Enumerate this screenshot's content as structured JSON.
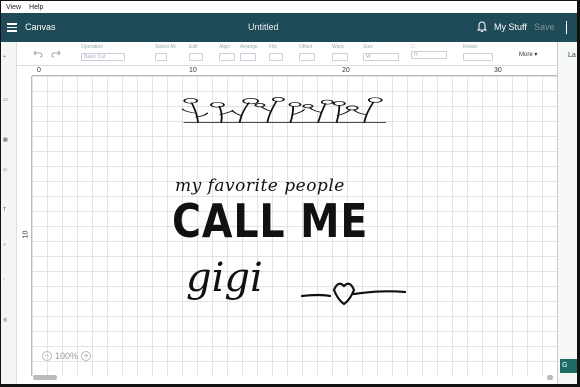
{
  "menu": {
    "items": [
      "View",
      "Help"
    ]
  },
  "titlebar": {
    "app": "Canvas",
    "document": "Untitled",
    "my_stuff": "My Stuff",
    "save": "Save"
  },
  "toolbar": {
    "tools": [
      {
        "label": "Operation",
        "value": "Basic Cut"
      },
      {
        "label": "Select All",
        "value": ""
      },
      {
        "label": "Edit",
        "value": ""
      },
      {
        "label": "Align",
        "value": ""
      },
      {
        "label": "Arrange",
        "value": ""
      },
      {
        "label": "Flip",
        "value": ""
      },
      {
        "label": "Offset",
        "value": ""
      },
      {
        "label": "Warp",
        "value": ""
      },
      {
        "label": "Size",
        "value": "W"
      },
      {
        "label": "",
        "value": "H"
      },
      {
        "label": "Rotate",
        "value": ""
      },
      {
        "label": "More ▾",
        "value": ""
      }
    ]
  },
  "ruler": {
    "h_ticks": [
      "0",
      "10",
      "20",
      "30"
    ],
    "v_ticks": [
      "10"
    ]
  },
  "design": {
    "line1": "my favorite people",
    "line2": "CALL ME",
    "line3": "gigi"
  },
  "zoom": {
    "level": "100%",
    "minus": "−",
    "plus": "+"
  },
  "right_panel": {
    "tab": "La"
  },
  "colors": {
    "titlebar": "#1f4a57",
    "accent": "#1c6b63",
    "grid": "#e3e3e3"
  },
  "icons": [
    "hamburger-icon",
    "bell-icon",
    "undo-icon",
    "redo-icon",
    "zoom-minus-icon",
    "zoom-plus-icon"
  ]
}
